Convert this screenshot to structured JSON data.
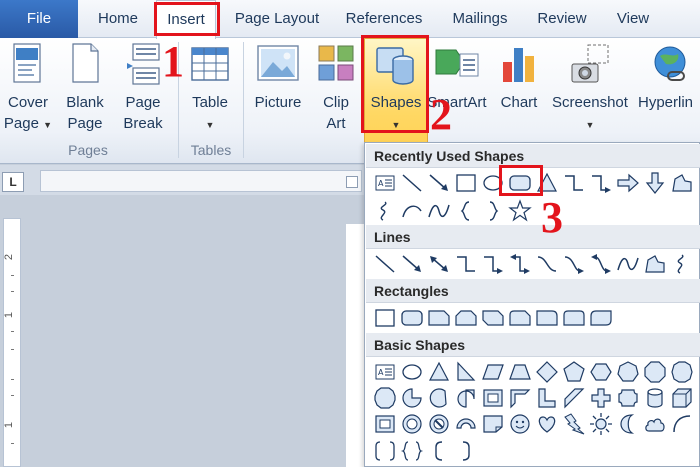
{
  "tabs": [
    {
      "key": "file",
      "label": "File"
    },
    {
      "key": "home",
      "label": "Home"
    },
    {
      "key": "insert",
      "label": "Insert"
    },
    {
      "key": "page_layout",
      "label": "Page Layout"
    },
    {
      "key": "references",
      "label": "References"
    },
    {
      "key": "mailings",
      "label": "Mailings"
    },
    {
      "key": "review",
      "label": "Review"
    },
    {
      "key": "view",
      "label": "View"
    }
  ],
  "active_tab": "Insert",
  "ribbon": {
    "pages_group": "Pages",
    "tables_group": "Tables",
    "buttons": {
      "cover_page": {
        "line1": "Cover",
        "line2": "Page"
      },
      "blank_page": {
        "line1": "Blank",
        "line2": "Page"
      },
      "page_break": {
        "line1": "Page",
        "line2": "Break"
      },
      "table": {
        "line1": "Table"
      },
      "picture": {
        "line1": "Picture"
      },
      "clip_art": {
        "line1": "Clip",
        "line2": "Art"
      },
      "shapes": {
        "line1": "Shapes"
      },
      "smartart": {
        "line1": "SmartArt"
      },
      "chart": {
        "line1": "Chart"
      },
      "screenshot": {
        "line1": "Screenshot"
      },
      "hyperlink": {
        "line1": "Hyperlin"
      }
    }
  },
  "shapes_menu": {
    "recently_used": "Recently Used Shapes",
    "lines": "Lines",
    "rectangles": "Rectangles",
    "basic_shapes": "Basic Shapes"
  },
  "steps": {
    "one": "1",
    "two": "2",
    "three": "3"
  },
  "ruler": {
    "corner": "L",
    "v_numbers": [
      "2",
      "1",
      "1"
    ]
  },
  "colors": {
    "accent": "#2a5aa6",
    "highlight": "#e3141c",
    "shape_stroke": "#1f3b63",
    "shape_fill": "#dce8f6"
  }
}
